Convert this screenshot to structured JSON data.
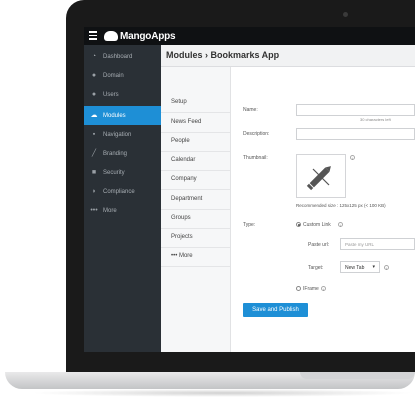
{
  "app": {
    "logo_text": "MangoApps"
  },
  "sidebar": {
    "items": [
      {
        "label": "Dashboard",
        "icon": "speedometer-icon",
        "glyph": "◔"
      },
      {
        "label": "Domain",
        "icon": "globe-icon",
        "glyph": "●"
      },
      {
        "label": "Users",
        "icon": "user-icon",
        "glyph": "●"
      },
      {
        "label": "Modules",
        "icon": "cloud-icon",
        "glyph": "☁"
      },
      {
        "label": "Navigation",
        "icon": "square-icon",
        "glyph": "▪"
      },
      {
        "label": "Branding",
        "icon": "brush-icon",
        "glyph": "╱"
      },
      {
        "label": "Security",
        "icon": "lock-icon",
        "glyph": "■"
      },
      {
        "label": "Compliance",
        "icon": "shield-icon",
        "glyph": "◗"
      },
      {
        "label": "More",
        "icon": "dots-icon",
        "glyph": "•••"
      }
    ],
    "active_index": 3
  },
  "header": {
    "title": "Modules › Bookmarks App"
  },
  "submenu": {
    "items": [
      "Setup",
      "News Feed",
      "People",
      "Calendar",
      "Company",
      "Department",
      "Groups",
      "Projects",
      "••• More"
    ]
  },
  "form": {
    "name_label": "Name:",
    "name_value": "",
    "name_hint": "30 characters left",
    "description_label": "Description:",
    "description_value": "",
    "thumbnail_label": "Thumbnail:",
    "thumbnail_hint": "Recommended size : 125x125 px (< 100 KB)",
    "type_label": "Type:",
    "custom_link_label": "Custom Link",
    "paste_url_label": "Paste url:",
    "paste_url_placeholder": "Paste my URL",
    "target_label": "Target:",
    "target_value": "New Tab",
    "iframe_label": "IFrame",
    "info_glyph": "i",
    "save_label": "Save and Publish"
  },
  "colors": {
    "accent": "#1e8fd6",
    "sidebar_bg": "#2a3036",
    "topbar_bg": "#0f1113"
  }
}
